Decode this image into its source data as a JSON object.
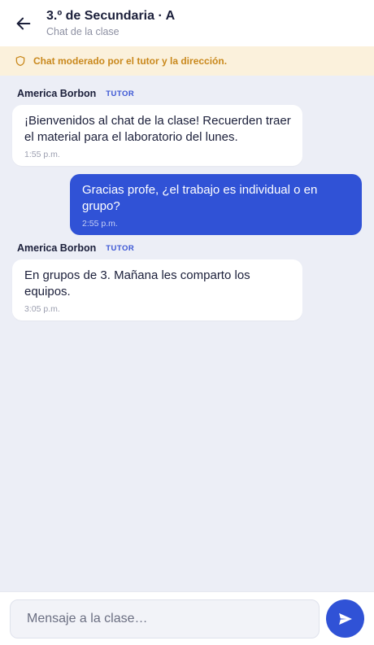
{
  "header": {
    "title": "3.º de Secundaria · A",
    "subtitle": "Chat de la clase",
    "back_icon": "arrow-left-icon"
  },
  "notice": {
    "icon": "shield-icon",
    "text": "Chat moderado por el tutor y la dirección."
  },
  "messages": [
    {
      "direction": "in",
      "sender": "America Borbon",
      "role": "TUTOR",
      "text": "¡Bienvenidos al chat de la clase! Recuerden traer el material para el laboratorio del lunes.",
      "time": "1:55 p.m."
    },
    {
      "direction": "out",
      "text": "Gracias profe, ¿el trabajo es individual o en grupo?",
      "time": "2:55 p.m."
    },
    {
      "direction": "in",
      "sender": "America Borbon",
      "role": "TUTOR",
      "text": "En grupos de 3. Mañana les comparto los equipos.",
      "time": "3:05 p.m."
    }
  ],
  "composer": {
    "placeholder": "Mensaje a la clase…",
    "send_icon": "send-icon"
  },
  "colors": {
    "accent": "#3052d6",
    "notice_bg": "#fbf1dc",
    "notice_text": "#c9881c",
    "chat_bg": "#eceef6"
  }
}
